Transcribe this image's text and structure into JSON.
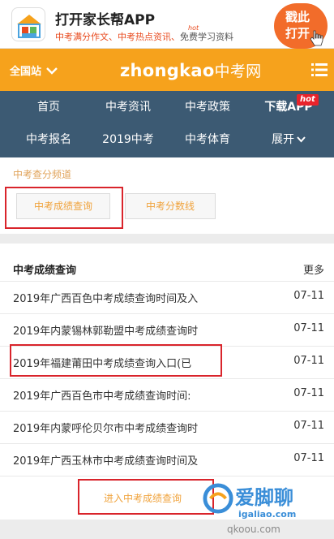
{
  "banner": {
    "title": "打开家长帮APP",
    "subtitle_part1": "中考满分作文、中考热点资讯、",
    "subtitle_part2": "免费学习资料",
    "hot_tag": "hot",
    "open_line1": "戳此",
    "open_line2": "打开"
  },
  "header": {
    "site_switch": "全国站",
    "brand_en": "zhongkao",
    "brand_cn": "中考网"
  },
  "nav": {
    "items": [
      "首页",
      "中考资讯",
      "中考政策",
      "下载APP",
      "中考报名",
      "2019中考",
      "中考体育",
      "展开"
    ],
    "hot_badge": "hot"
  },
  "channel": {
    "label": "中考查分频道",
    "buttons": [
      "中考成绩查询",
      "中考分数线"
    ]
  },
  "list": {
    "title": "中考成绩查询",
    "more": "更多",
    "rows": [
      {
        "text": "2019年广西百色中考成绩查询时间及入",
        "date": "07-11"
      },
      {
        "text": "2019年内蒙锡林郭勒盟中考成绩查询时",
        "date": "07-11"
      },
      {
        "text": "2019年福建莆田中考成绩查询入口(已",
        "date": "07-11"
      },
      {
        "text": "2019年广西百色市中考成绩查询时间:",
        "date": "07-11"
      },
      {
        "text": "2019年内蒙呼伦贝尔市中考成绩查询时",
        "date": "07-11"
      },
      {
        "text": "2019年广西玉林市中考成绩查询时间及",
        "date": "07-11"
      }
    ],
    "enter_link": "进入中考成绩查询"
  },
  "watermark": {
    "line1": "爱脚聊",
    "line2": "igaliao.com",
    "line3": "qkoou.com"
  }
}
